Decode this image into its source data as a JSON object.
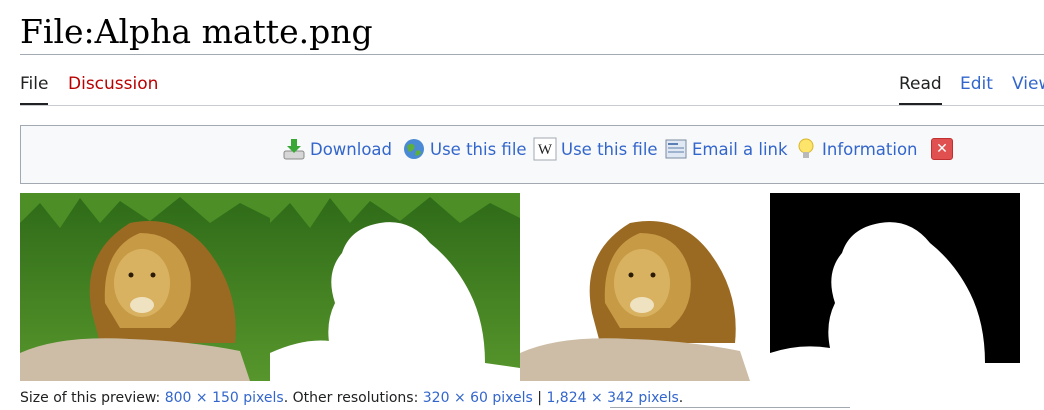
{
  "page": {
    "title": "File:Alpha matte.png"
  },
  "tabs": {
    "left": [
      {
        "label": "File",
        "active": true
      },
      {
        "label": "Discussion",
        "active": false
      }
    ],
    "right": [
      {
        "label": "Read",
        "active": true
      },
      {
        "label": "Edit",
        "active": false
      },
      {
        "label": "View",
        "active": false
      }
    ]
  },
  "toolbar": {
    "items": [
      {
        "label": "Download",
        "icon": "download-icon"
      },
      {
        "label": "Use this file",
        "icon": "globe-icon"
      },
      {
        "label": "Use this file",
        "icon": "wikipedia-icon"
      },
      {
        "label": "Email a link",
        "icon": "email-icon"
      },
      {
        "label": "Information",
        "icon": "lightbulb-icon"
      }
    ],
    "close_icon": "close-icon"
  },
  "preview": {
    "panels": [
      "lion-photo",
      "lion-with-white-mask",
      "lion-cutout-on-white",
      "alpha-matte-black-white"
    ],
    "colors": {
      "grass": "#3f7d1f",
      "mane": "#a87a2c",
      "rock": "#c9b9a3",
      "matte_black": "#000000"
    }
  },
  "caption": {
    "size_label": "Size of this preview:",
    "preview_size": "800 × 150 pixels",
    "other_label": ". Other resolutions:",
    "res_small": "320 × 60 pixels",
    "separator": "|",
    "res_large": "1,824 × 342 pixels",
    "end": "."
  }
}
